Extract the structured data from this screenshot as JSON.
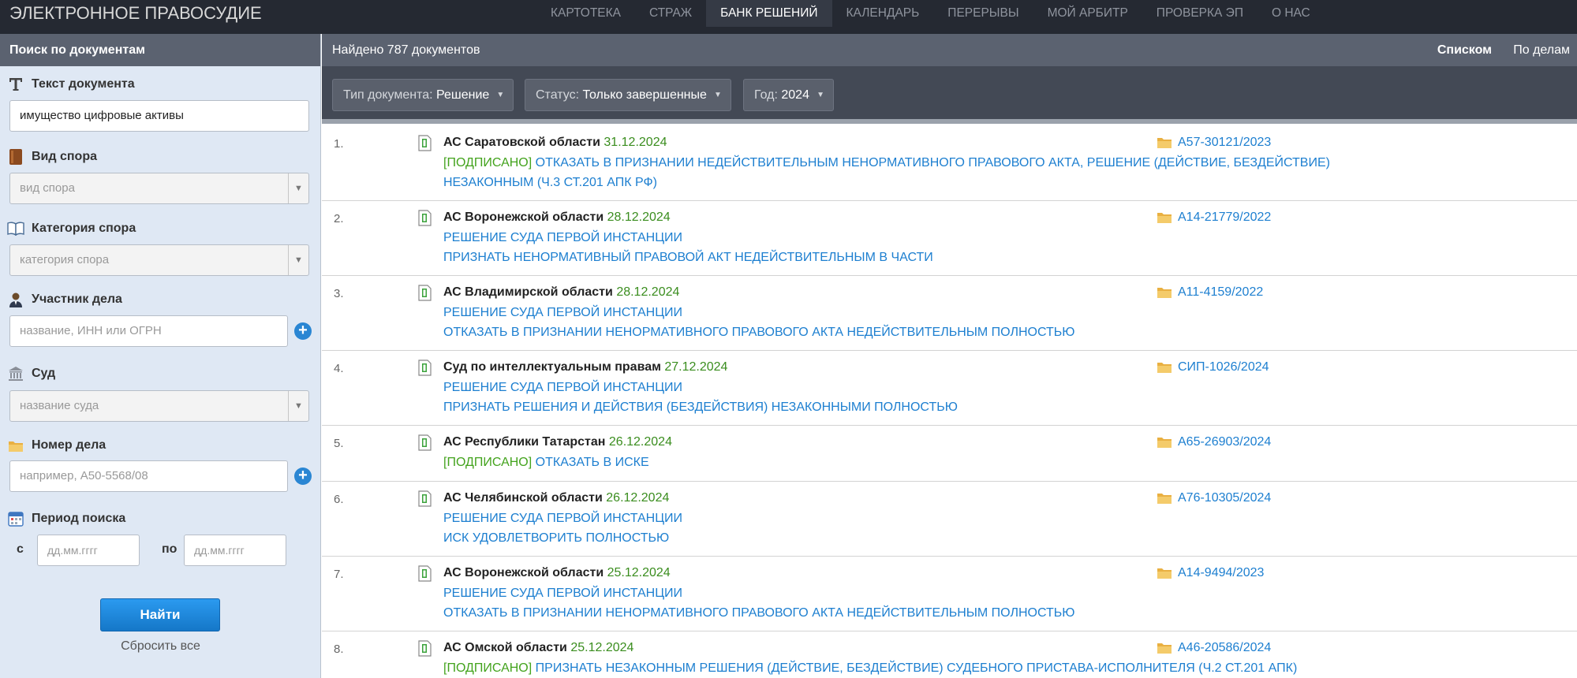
{
  "topbar": {
    "logo": "ЭЛЕКТРОННОЕ ПРАВОСУДИЕ",
    "nav": [
      "КАРТОТЕКА",
      "СТРАЖ",
      "БАНК РЕШЕНИЙ",
      "КАЛЕНДАРЬ",
      "ПЕРЕРЫВЫ",
      "МОЙ АРБИТР",
      "ПРОВЕРКА ЭП",
      "О НАС"
    ],
    "active": "БАНК РЕШЕНИЙ"
  },
  "sidebar": {
    "title": "Поиск по документам",
    "text_label": "Текст документа",
    "text_value": "имущество цифровые активы",
    "dispute_label": "Вид спора",
    "dispute_placeholder": "вид спора",
    "category_label": "Категория спора",
    "category_placeholder": "категория спора",
    "participant_label": "Участник дела",
    "participant_placeholder": "название, ИНН или ОГРН",
    "court_label": "Суд",
    "court_placeholder": "название суда",
    "case_label": "Номер дела",
    "case_placeholder": "например, А50-5568/08",
    "period_label": "Период поиска",
    "from_label": "с",
    "to_label": "по",
    "date_placeholder": "дд.мм.гггг",
    "find_button": "Найти",
    "reset_link": "Сбросить все"
  },
  "main": {
    "found": "Найдено 787 документов",
    "view_list": "Списком",
    "view_cases": "По делам",
    "filters": {
      "doc_type_label": "Тип документа:",
      "doc_type_value": "Решение",
      "status_label": "Статус:",
      "status_value": "Только завершенные",
      "year_label": "Год:",
      "year_value": "2024"
    }
  },
  "results": [
    {
      "num": "1.",
      "court": "АС Саратовской области",
      "date": "31.12.2024",
      "signed": "[ПОДПИСАНО]",
      "line1": "ОТКАЗАТЬ В ПРИЗНАНИИ НЕДЕЙСТВИТЕЛЬНЫМ НЕНОРМАТИВНОГО ПРАВОВОГО АКТА, РЕШЕНИЕ (ДЕЙСТВИЕ, БЕЗДЕЙСТВИЕ)",
      "line2": "НЕЗАКОННЫМ (Ч.3 СТ.201 АПК РФ)",
      "case": "А57-30121/2023"
    },
    {
      "num": "2.",
      "court": "АС Воронежской области",
      "date": "28.12.2024",
      "signed": "",
      "line1": "РЕШЕНИЕ СУДА ПЕРВОЙ ИНСТАНЦИИ",
      "line2": "ПРИЗНАТЬ НЕНОРМАТИВНЫЙ ПРАВОВОЙ АКТ НЕДЕЙСТВИТЕЛЬНЫМ В ЧАСТИ",
      "case": "А14-21779/2022"
    },
    {
      "num": "3.",
      "court": "АС Владимирской области",
      "date": "28.12.2024",
      "signed": "",
      "line1": "РЕШЕНИЕ СУДА ПЕРВОЙ ИНСТАНЦИИ",
      "line2": "ОТКАЗАТЬ В ПРИЗНАНИИ НЕНОРМАТИВНОГО ПРАВОВОГО АКТА НЕДЕЙСТВИТЕЛЬНЫМ ПОЛНОСТЬЮ",
      "case": "А11-4159/2022"
    },
    {
      "num": "4.",
      "court": "Суд по интеллектуальным правам",
      "date": "27.12.2024",
      "signed": "",
      "line1": "РЕШЕНИЕ СУДА ПЕРВОЙ ИНСТАНЦИИ",
      "line2": "ПРИЗНАТЬ РЕШЕНИЯ И ДЕЙСТВИЯ (БЕЗДЕЙСТВИЯ) НЕЗАКОННЫМИ ПОЛНОСТЬЮ",
      "case": "СИП-1026/2024"
    },
    {
      "num": "5.",
      "court": "АС Республики Татарстан",
      "date": "26.12.2024",
      "signed": "[ПОДПИСАНО]",
      "line1": "ОТКАЗАТЬ В ИСКЕ",
      "line2": "",
      "case": "А65-26903/2024"
    },
    {
      "num": "6.",
      "court": "АС Челябинской области",
      "date": "26.12.2024",
      "signed": "",
      "line1": "РЕШЕНИЕ СУДА ПЕРВОЙ ИНСТАНЦИИ",
      "line2": "ИСК УДОВЛЕТВОРИТЬ ПОЛНОСТЬЮ",
      "case": "А76-10305/2024"
    },
    {
      "num": "7.",
      "court": "АС Воронежской области",
      "date": "25.12.2024",
      "signed": "",
      "line1": "РЕШЕНИЕ СУДА ПЕРВОЙ ИНСТАНЦИИ",
      "line2": "ОТКАЗАТЬ В ПРИЗНАНИИ НЕНОРМАТИВНОГО ПРАВОВОГО АКТА НЕДЕЙСТВИТЕЛЬНЫМ ПОЛНОСТЬЮ",
      "case": "А14-9494/2023"
    },
    {
      "num": "8.",
      "court": "АС Омской области",
      "date": "25.12.2024",
      "signed": "[ПОДПИСАНО]",
      "line1": "ПРИЗНАТЬ НЕЗАКОННЫМ РЕШЕНИЯ (ДЕЙСТВИЕ, БЕЗДЕЙСТВИЕ) СУДЕБНОГО ПРИСТАВА-ИСПОЛНИТЕЛЯ (Ч.2 СТ.201 АПК)",
      "line2": "",
      "case": "А46-20586/2024"
    }
  ]
}
